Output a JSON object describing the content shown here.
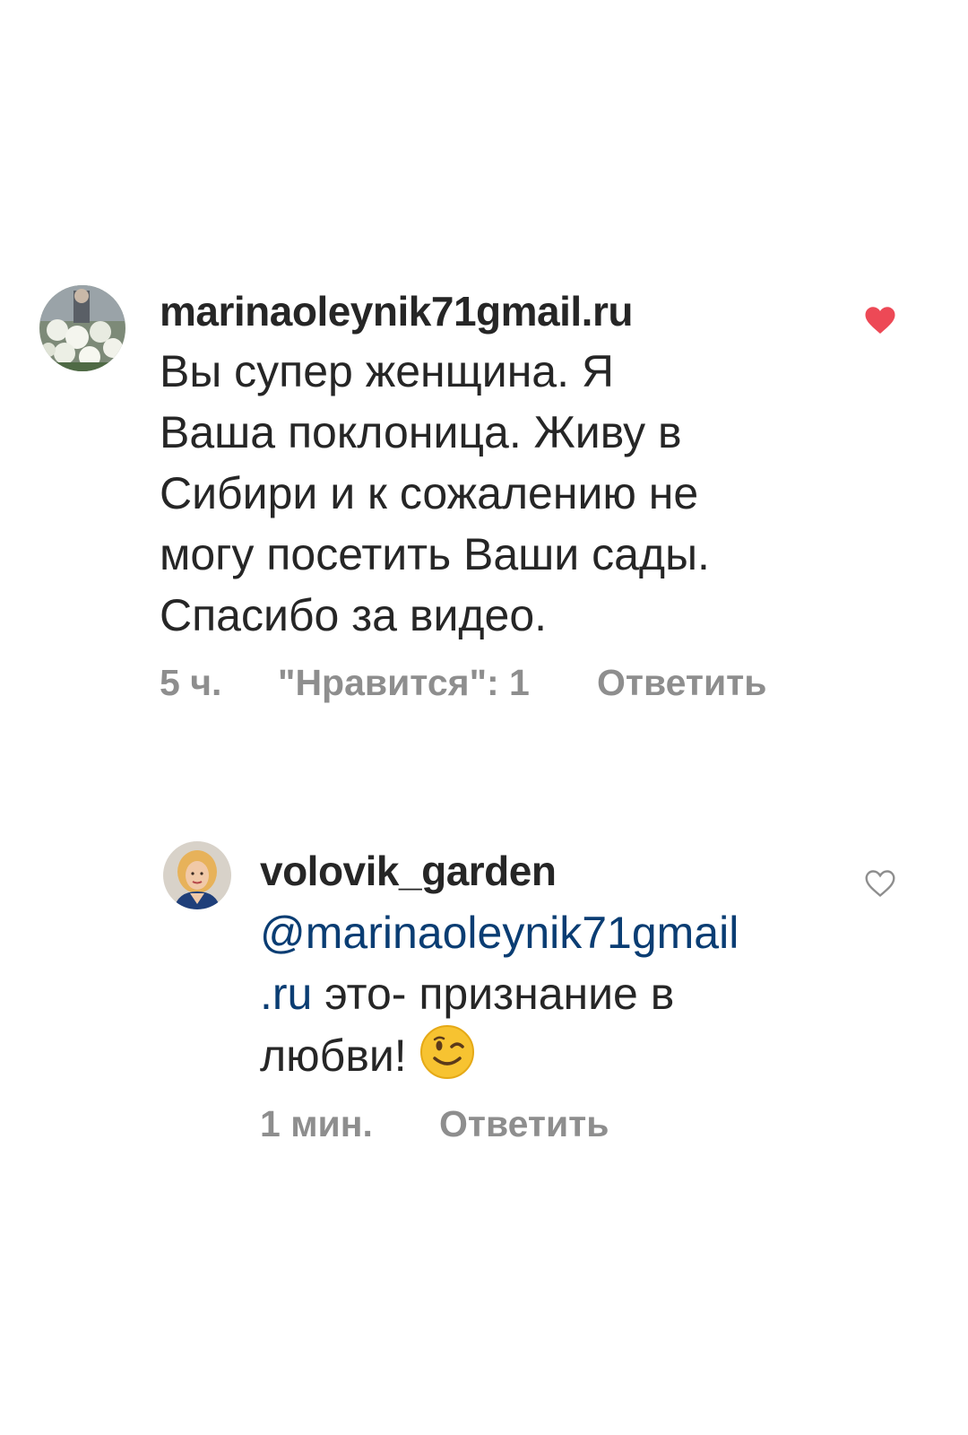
{
  "comments": [
    {
      "username": "marinaoleynik71gmail.ru",
      "text": "Вы супер женщина. Я\nВаша поклоница. Живу в\nСибири  и к сожалению не\nмогу посетить Ваши сады.\nСпасибо за видео.",
      "time": "5 ч.",
      "likes": "\"Нравится\": 1",
      "reply": "Ответить",
      "liked": true,
      "heart_color": "#ed4956"
    },
    {
      "username": "volovik_garden",
      "mention_line1": "@marinaoleynik71gmail",
      "mention_line2": ".ru",
      "text_after_mention": " это- признание в",
      "text_line3": "любви!",
      "emoji": "winking-face",
      "time": "1 мин.",
      "reply": "Ответить",
      "liked": false,
      "heart_color": "#8e8e8e"
    }
  ],
  "colors": {
    "text": "#262626",
    "meta": "#8e8e8e",
    "mention": "#0a3d73",
    "like": "#ed4956"
  }
}
